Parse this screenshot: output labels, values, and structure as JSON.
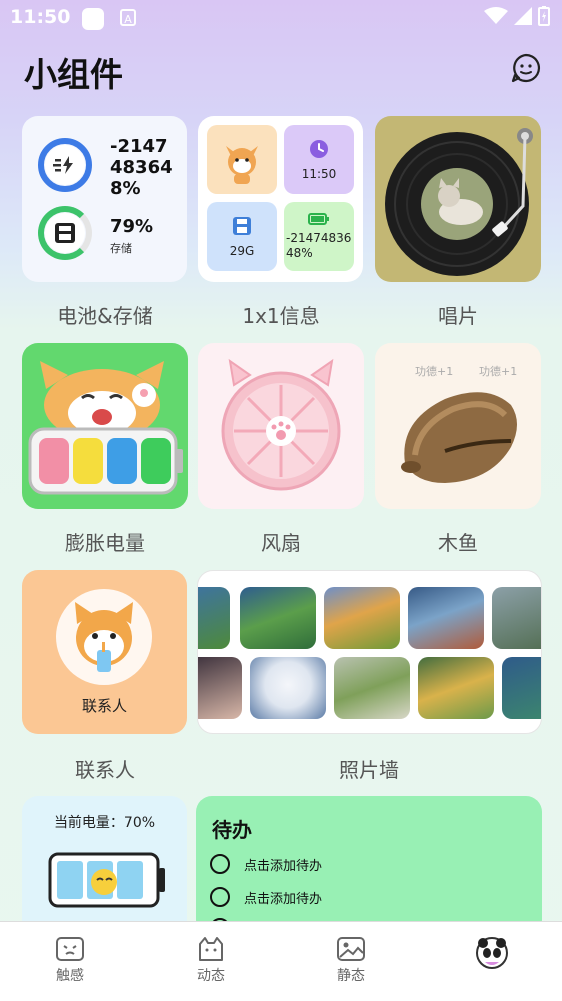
{
  "status": {
    "time": "11:50",
    "badge": "A"
  },
  "header": {
    "title": "小组件"
  },
  "widgets": {
    "battery_storage": {
      "label": "电池&存储",
      "battery_value": "-2147483648%",
      "storage_value": "79%",
      "storage_caption": "存储",
      "battery_color": "#3d7be6",
      "storage_color": "#3cc36a"
    },
    "info_1x1": {
      "label": "1x1信息",
      "time": "11:50",
      "storage": "29G",
      "battery": "-2147483648%"
    },
    "record": {
      "label": "唱片"
    },
    "inflate_battery": {
      "label": "膨胀电量"
    },
    "fan": {
      "label": "风扇"
    },
    "wooden_fish": {
      "label": "木鱼",
      "merit_left": "功德+1",
      "merit_right": "功德+1"
    },
    "contact": {
      "label": "联系人",
      "card_name": "联系人"
    },
    "photo_wall": {
      "label": "照片墙"
    },
    "current_battery": {
      "text": "当前电量：70%",
      "level": 0.7
    },
    "todo": {
      "title": "待办",
      "items": [
        "点击添加待办",
        "点击添加待办"
      ]
    }
  },
  "tabs": [
    {
      "label": "触感",
      "icon": "touch-face-icon"
    },
    {
      "label": "动态",
      "icon": "dynamic-cat-icon"
    },
    {
      "label": "静态",
      "icon": "static-image-icon"
    },
    {
      "label": "",
      "icon": "panda-avatar-icon"
    }
  ]
}
